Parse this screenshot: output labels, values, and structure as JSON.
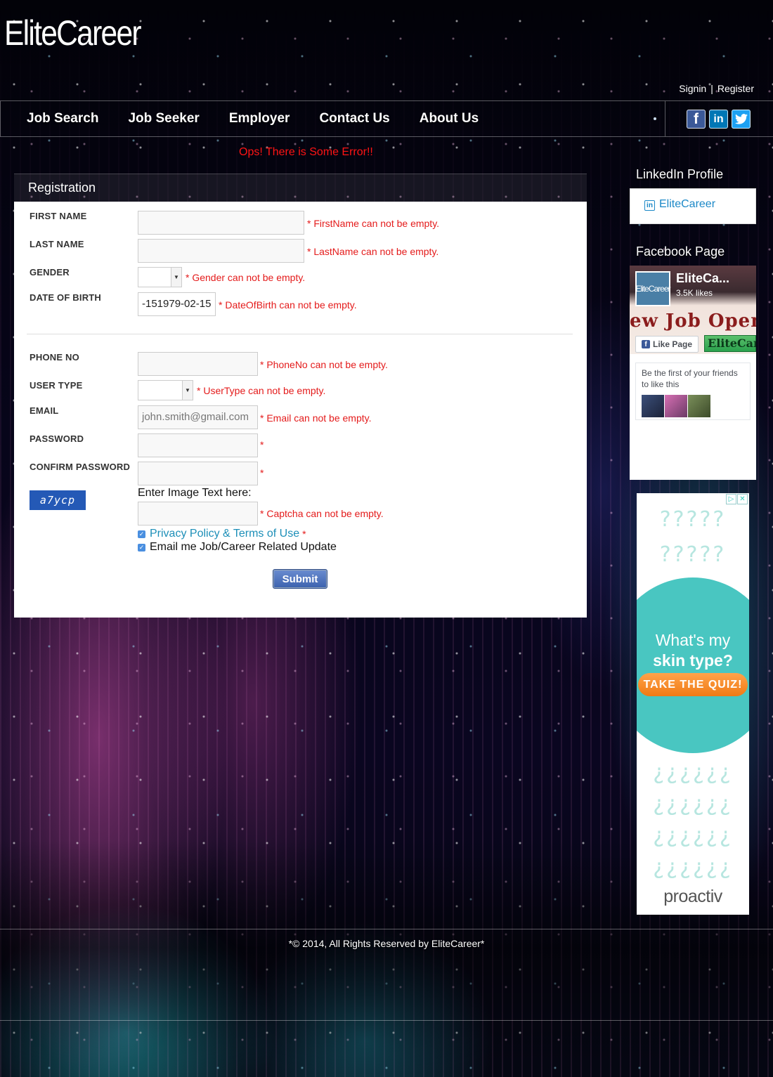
{
  "brand": {
    "logo_text": "EliteCareer"
  },
  "auth": {
    "signin": "Signin",
    "separator": "|",
    "register": "Register"
  },
  "nav": {
    "items": [
      "Job Search",
      "Job Seeker",
      "Employer",
      "Contact Us",
      "About Us"
    ]
  },
  "social": {
    "facebook": "f",
    "linkedin": "in",
    "twitter": "t"
  },
  "alert": {
    "error_text": "Ops! There is Some Error!!"
  },
  "registration": {
    "panel_title": "Registration",
    "fields": {
      "first_name": {
        "label": "FIRST NAME",
        "value": "",
        "error": "FirstName can not be empty."
      },
      "last_name": {
        "label": "LAST NAME",
        "value": "",
        "error": "LastName can not be empty."
      },
      "gender": {
        "label": "GENDER",
        "value": "",
        "error": "Gender can not be empty."
      },
      "dob": {
        "label": "DATE OF BIRTH",
        "value": "-151979-02-15",
        "error": "DateOfBirth can not be empty."
      },
      "phone": {
        "label": "PHONE NO",
        "value": "",
        "error": "PhoneNo can not be empty."
      },
      "user_type": {
        "label": "USER TYPE",
        "value": "",
        "error": "UserType can not be empty."
      },
      "email": {
        "label": "EMAIL",
        "placeholder": "john.smith@gmail.com",
        "error": "Email can not be empty."
      },
      "password": {
        "label": "PASSWORD",
        "value": ""
      },
      "confirm_password": {
        "label": "CONFIRM PASSWORD",
        "value": ""
      },
      "captcha": {
        "image_text": "a7ycp",
        "prompt": "Enter Image Text here:",
        "value": "",
        "error": "Captcha can not be empty."
      }
    },
    "required_star": "*",
    "privacy_label": "Privacy Policy & Terms of Use",
    "newsletter_label": "Email me Job/Career Related Update",
    "submit_label": "Submit"
  },
  "sidebar": {
    "linkedin_title": "LinkedIn Profile",
    "linkedin_link": "EliteCareer",
    "facebook_title": "Facebook Page",
    "fb_page_name": "EliteCa...",
    "fb_likes": "3.5K likes",
    "fb_avatar_text": "EliteCareer",
    "fb_cover_text": "ew Job Openi",
    "fb_like_button": "Like Page",
    "fb_cover_badge": "EliteCar",
    "fb_friends_text": "Be the first of your friends to like this"
  },
  "ad": {
    "line1": "What's my",
    "line2": "skin type?",
    "cta": "TAKE THE QUIZ!",
    "brand": "proactiv",
    "adchoices": "▷",
    "close": "✕"
  },
  "footer": {
    "copyright": "*© 2014, All Rights Reserved by EliteCareer*"
  }
}
